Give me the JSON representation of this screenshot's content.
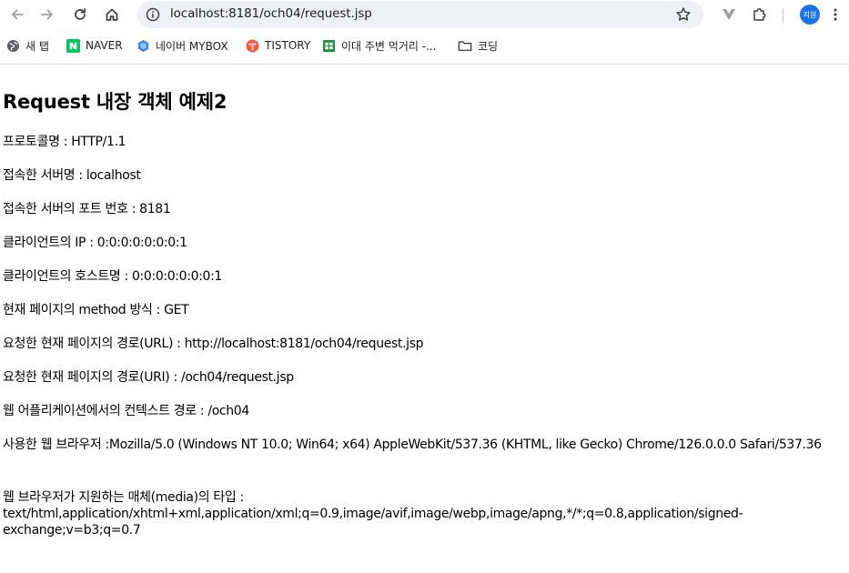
{
  "browser": {
    "url": "localhost:8181/och04/request.jsp",
    "profile_label": "지원"
  },
  "bookmarks": [
    {
      "label": "새 탭",
      "icon": "globe-icon"
    },
    {
      "label": "NAVER",
      "icon": "naver-icon"
    },
    {
      "label": "네이버 MYBOX",
      "icon": "mybox-icon"
    },
    {
      "label": "TISTORY",
      "icon": "tistory-icon"
    },
    {
      "label": "이대 주변 먹거리 -...",
      "icon": "sheets-icon"
    },
    {
      "label": "코딩",
      "icon": "folder-icon"
    }
  ],
  "page": {
    "title": "Request 내장 객체 예제2",
    "lines": [
      "프로토콜명 : HTTP/1.1",
      "접속한 서버명 : localhost",
      "접속한 서버의 포트 번호 : 8181",
      "클라이언트의 IP : 0:0:0:0:0:0:0:1",
      "클라이언트의 호스트명 : 0:0:0:0:0:0:0:1",
      "현재 페이지의 method 방식 : GET",
      "요청한 현재 페이지의 경로(URL) : http://localhost:8181/och04/request.jsp",
      "요청한 현재 페이지의 경로(URI) : /och04/request.jsp",
      "웹 어플리케이션에서의 컨텍스트 경로 : /och04",
      "사용한 웹 브라우저 :Mozilla/5.0 (Windows NT 10.0; Win64; x64) AppleWebKit/537.36 (KHTML, like Gecko) Chrome/126.0.0.0 Safari/537.36",
      "웹 브라우저가 지원하는 매체(media)의 타입 : text/html,application/xhtml+xml,application/xml;q=0.9,image/avif,image/webp,image/apng,*/*;q=0.8,application/signed-exchange;v=b3;q=0.7"
    ]
  }
}
